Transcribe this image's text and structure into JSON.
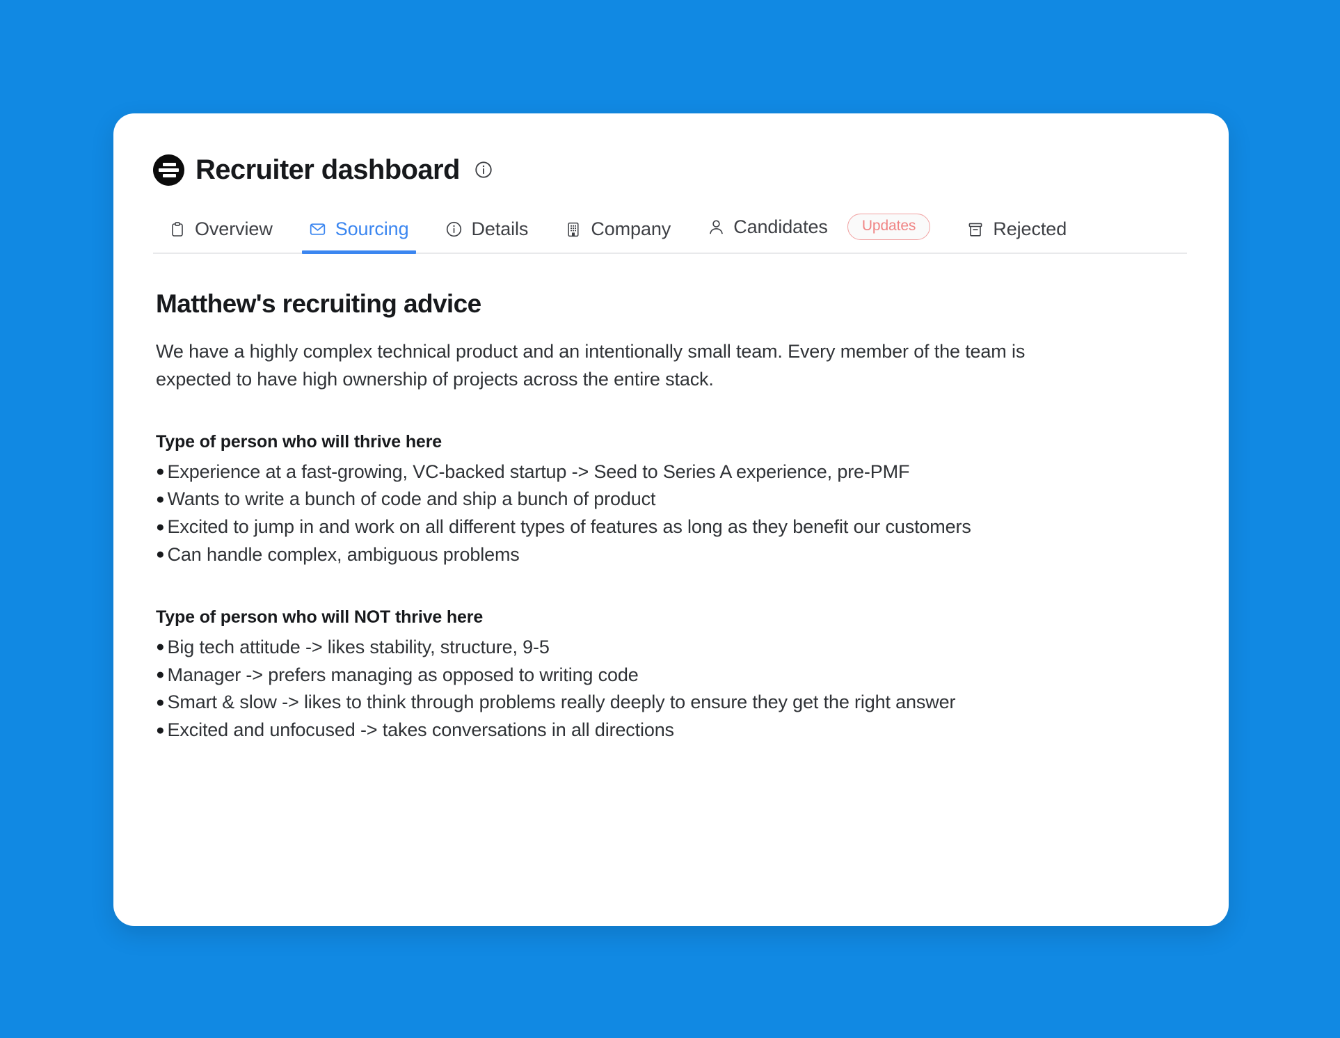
{
  "theme": {
    "page_background": "#1189e3",
    "card_background": "#ffffff",
    "accent_blue": "#3b86f0",
    "badge_red": "#f08484",
    "text_primary": "#17191c",
    "text_body": "#2f3236"
  },
  "header": {
    "logo_icon": "stacked-bars-circle-logo",
    "title": "Recruiter dashboard",
    "info_icon": "info-circle-icon"
  },
  "tabs": [
    {
      "id": "overview",
      "label": "Overview",
      "icon": "clipboard-icon",
      "active": false
    },
    {
      "id": "sourcing",
      "label": "Sourcing",
      "icon": "envelope-icon",
      "active": true
    },
    {
      "id": "details",
      "label": "Details",
      "icon": "info-circle-icon",
      "active": false
    },
    {
      "id": "company",
      "label": "Company",
      "icon": "building-icon",
      "active": false
    },
    {
      "id": "candidates",
      "label": "Candidates",
      "icon": "person-icon",
      "active": false,
      "badge": "Updates"
    },
    {
      "id": "rejected",
      "label": "Rejected",
      "icon": "archive-box-icon",
      "active": false
    }
  ],
  "main": {
    "title": "Matthew's recruiting advice",
    "intro": "We have a highly complex technical product and an intentionally small team. Every member of the team is expected to have high ownership of projects across the entire stack.",
    "groups": [
      {
        "heading": "Type of person who will thrive here",
        "bullets": [
          "Experience at a fast-growing, VC-backed startup -> Seed to Series A experience, pre-PMF",
          "Wants to write a bunch of code and ship a bunch of product",
          "Excited to jump in and work on all different types of features as long as they benefit our customers",
          "Can handle complex, ambiguous problems"
        ]
      },
      {
        "heading": "Type of person who will NOT thrive here",
        "bullets": [
          "Big tech attitude -> likes stability, structure, 9-5",
          "Manager -> prefers managing as opposed to writing code",
          "Smart & slow -> likes to think through problems really deeply to ensure they get the right answer",
          "Excited and unfocused -> takes conversations in all directions"
        ]
      }
    ],
    "bullet_glyph": "●"
  }
}
